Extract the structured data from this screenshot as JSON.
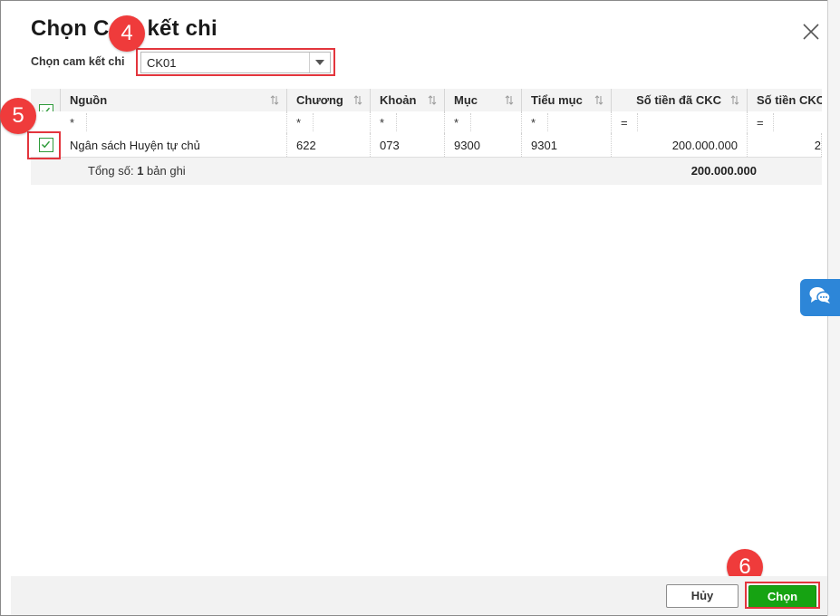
{
  "dialog": {
    "title": "Chọn Cam kết chi",
    "close_icon": "close-icon"
  },
  "commitment_select": {
    "label": "Chọn cam kết chi",
    "value": "CK01"
  },
  "grid": {
    "columns": [
      {
        "key": "nguon",
        "label": "Nguồn",
        "filter_op": "*"
      },
      {
        "key": "chuong",
        "label": "Chương",
        "filter_op": "*"
      },
      {
        "key": "khoan",
        "label": "Khoản",
        "filter_op": "*"
      },
      {
        "key": "muc",
        "label": "Mục",
        "filter_op": "*"
      },
      {
        "key": "tieu_muc",
        "label": "Tiểu mục",
        "filter_op": "*"
      },
      {
        "key": "so_tien_da_ckc",
        "label": "Số tiền đã CKC",
        "filter_op": "="
      },
      {
        "key": "so_tien_ckc",
        "label": "Số tiền CKC",
        "filter_op": "="
      }
    ],
    "rows": [
      {
        "checked": true,
        "nguon": "Ngân sách Huyện tự chủ",
        "chuong": "622",
        "khoan": "073",
        "muc": "9300",
        "tieu_muc": "9301",
        "so_tien_da_ckc": "200.000.000",
        "so_tien_ckc": "2"
      }
    ],
    "summary": {
      "prefix": "Tổng số: ",
      "count": "1",
      "suffix": " bản ghi",
      "total_da_ckc": "200.000.000"
    },
    "select_all_checked": true
  },
  "steps": {
    "s4": "4",
    "s5": "5",
    "s6": "6"
  },
  "footer": {
    "cancel_label": "Hủy",
    "ok_label": "Chọn"
  },
  "colors": {
    "accent_green": "#16a312",
    "highlight_red": "#e3353d",
    "chat_blue": "#2d86d8"
  }
}
